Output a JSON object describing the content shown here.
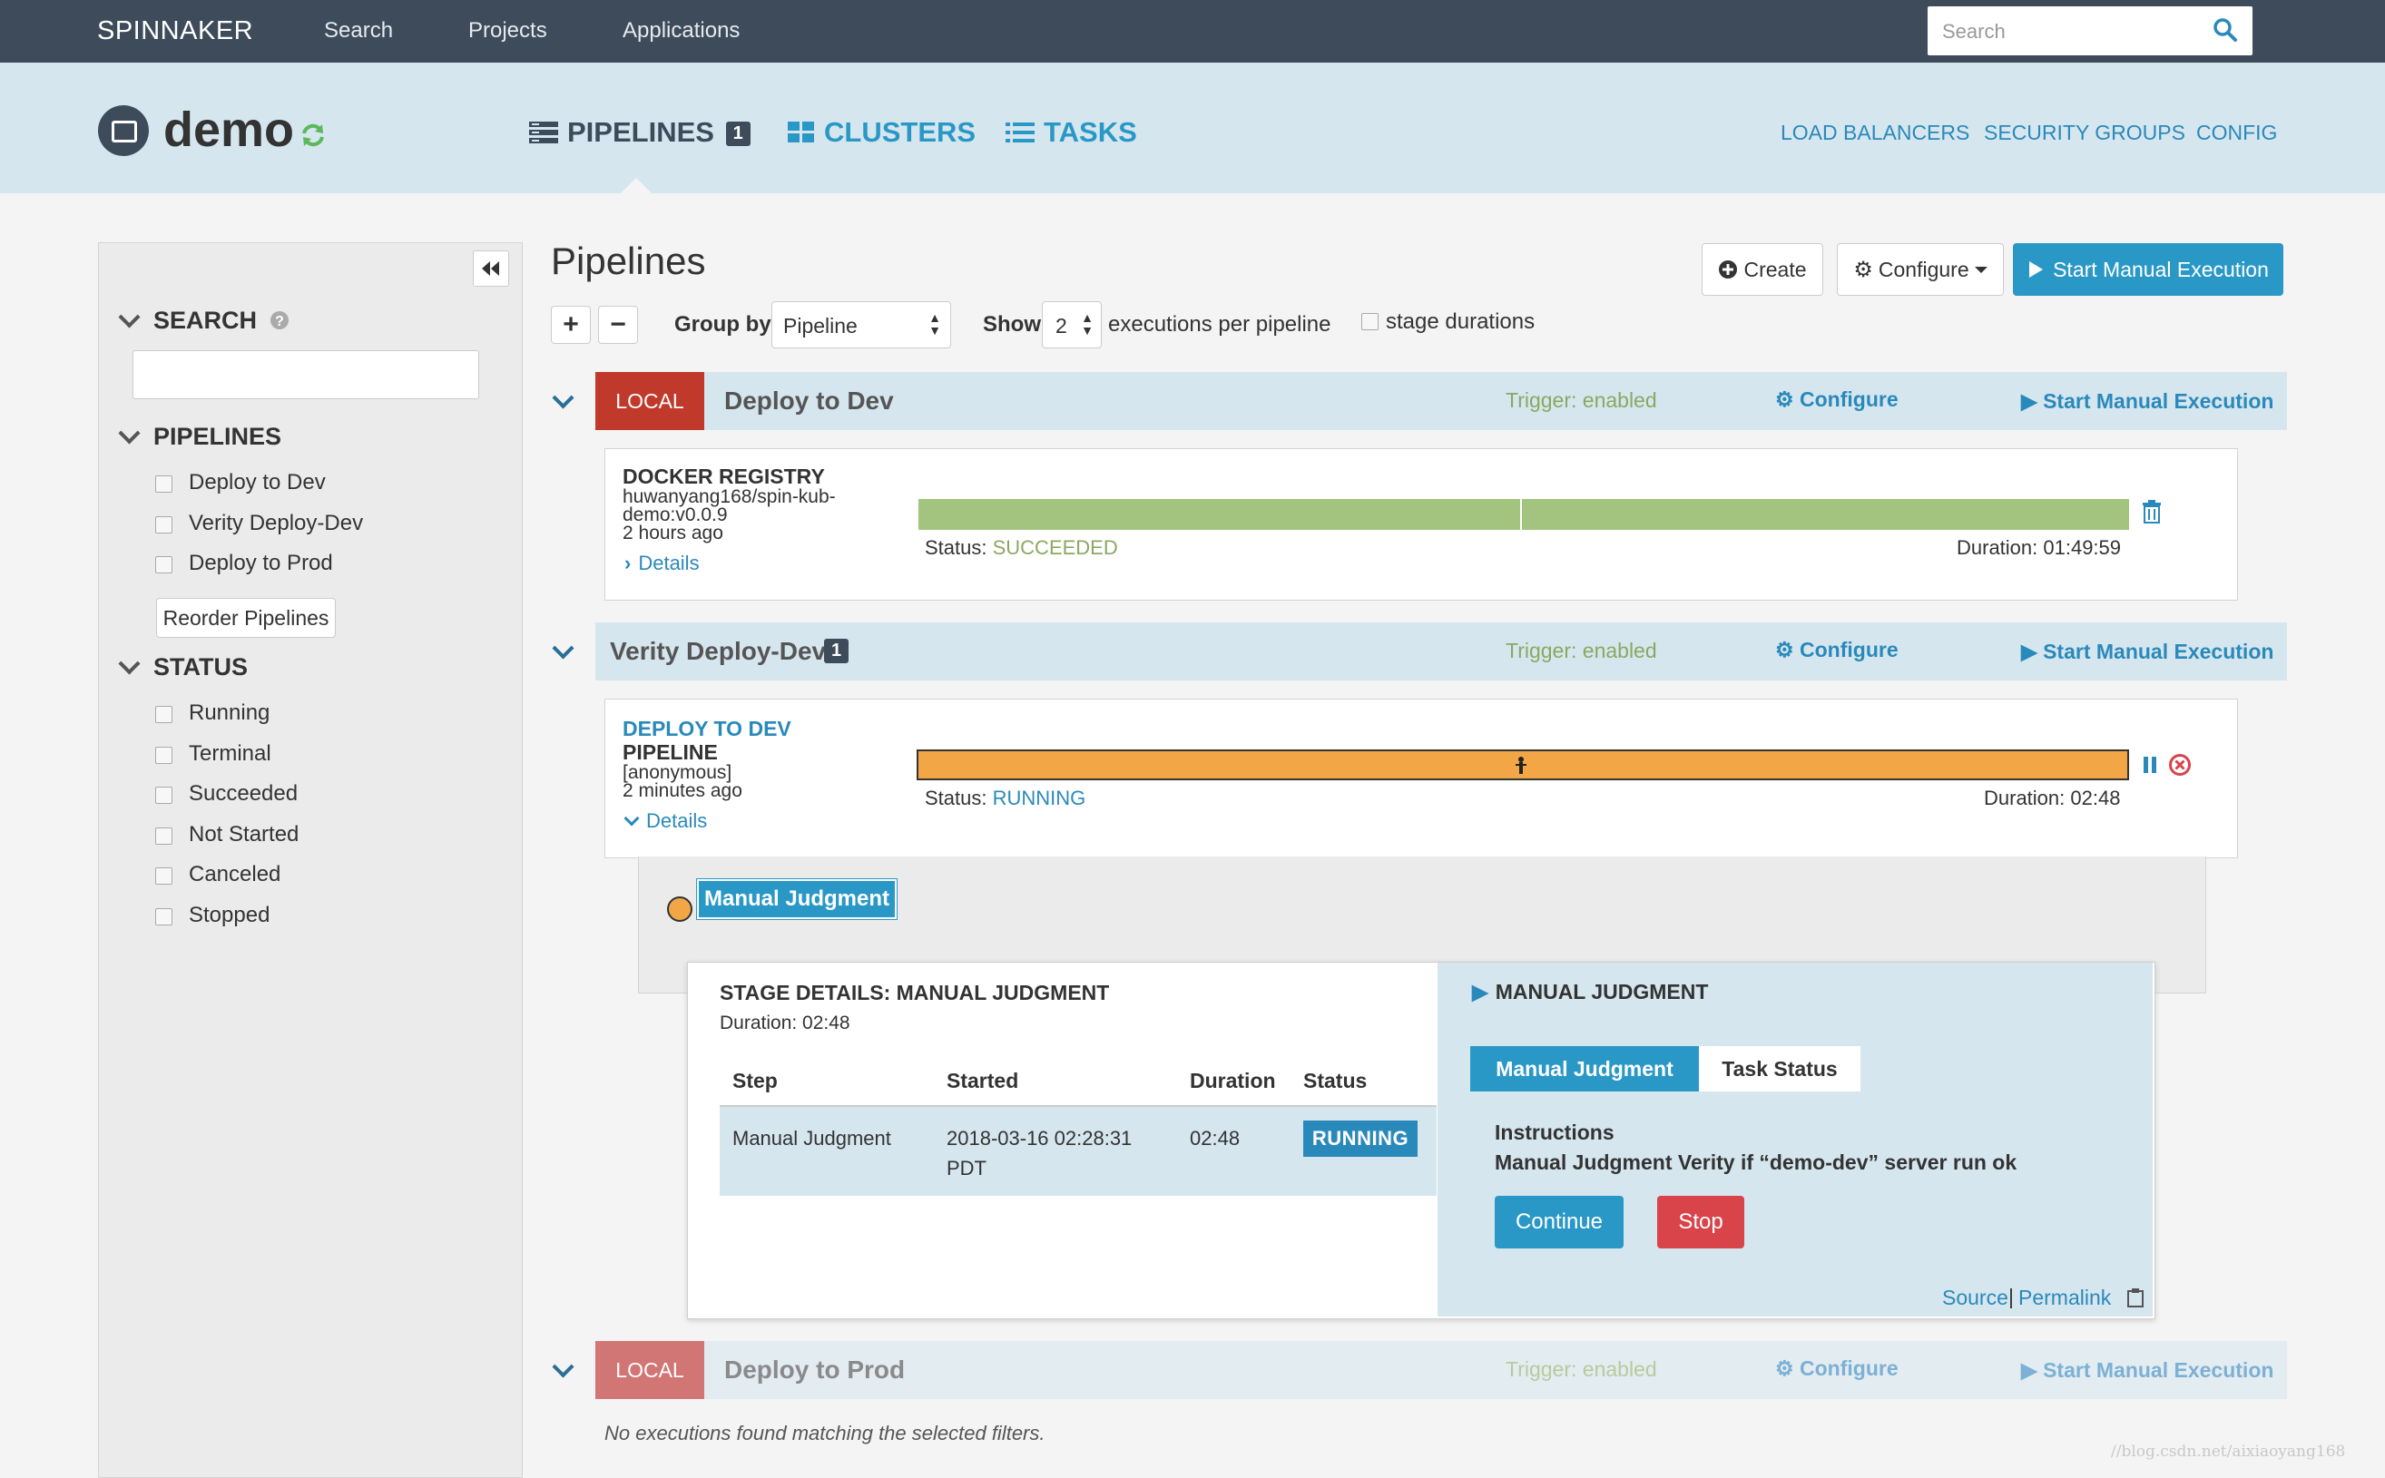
{
  "topnav": {
    "brand": "SPINNAKER",
    "links": [
      "Search",
      "Projects",
      "Applications"
    ],
    "search_placeholder": "Search"
  },
  "app": {
    "name": "demo",
    "tabs": [
      {
        "label": "PIPELINES",
        "badge": "1"
      },
      {
        "label": "CLUSTERS"
      },
      {
        "label": "TASKS"
      }
    ],
    "right_links": [
      "LOAD BALANCERS",
      "SECURITY GROUPS",
      "CONFIG"
    ]
  },
  "sidebar": {
    "search_heading": "SEARCH",
    "pipelines_heading": "PIPELINES",
    "pipelines": [
      "Deploy to Dev",
      "Verity Deploy-Dev",
      "Deploy to Prod"
    ],
    "reorder_label": "Reorder Pipelines",
    "status_heading": "STATUS",
    "statuses": [
      "Running",
      "Terminal",
      "Succeeded",
      "Not Started",
      "Canceled",
      "Stopped"
    ]
  },
  "main": {
    "title": "Pipelines",
    "create_label": "Create",
    "configure_label": "Configure",
    "start_manual_label": "Start Manual Execution",
    "group_by_label": "Group by",
    "group_by_value": "Pipeline",
    "show_label": "Show",
    "show_value": "2",
    "per_pipeline_label": "executions per pipeline",
    "stage_durations_label": "stage durations"
  },
  "groups": [
    {
      "badge": "LOCAL",
      "name": "Deploy to Dev",
      "trigger": "Trigger: enabled",
      "configure": "Configure",
      "start": "Start Manual Execution",
      "exec": {
        "trigger_type": "DOCKER REGISTRY",
        "line1": "huwanyang168/spin-kub-",
        "line2": "demo:v0.0.9",
        "age": "2 hours ago",
        "details": "Details",
        "status_label": "Status:",
        "status": "SUCCEEDED",
        "duration": "Duration: 01:49:59",
        "progress": 1.0
      }
    },
    {
      "name": "Verity Deploy-Dev",
      "badge_count": "1",
      "trigger": "Trigger: enabled",
      "configure": "Configure",
      "start": "Start Manual Execution",
      "exec": {
        "trigger_type": "DEPLOY TO DEV",
        "line1": "PIPELINE",
        "line2": "[anonymous]",
        "age": "2 minutes ago",
        "details": "Details",
        "status_label": "Status:",
        "status": "RUNNING",
        "duration": "Duration: 02:48",
        "progress": 1.0
      }
    },
    {
      "badge": "LOCAL",
      "name": "Deploy to Prod",
      "trigger": "Trigger: enabled",
      "configure": "Configure",
      "start": "Start Manual Execution",
      "empty": "No executions found matching the selected filters."
    }
  ],
  "stage": {
    "label": "Manual Judgment",
    "details_title": "STAGE DETAILS: MANUAL JUDGMENT",
    "duration": "Duration: 02:48",
    "columns": [
      "Step",
      "Started",
      "Duration",
      "Status"
    ],
    "row": {
      "step": "Manual Judgment",
      "started1": "2018-03-16 02:28:31",
      "started2": "PDT",
      "duration": "02:48",
      "status": "RUNNING"
    },
    "right_title": "MANUAL JUDGMENT",
    "tabs": [
      "Manual Judgment",
      "Task Status"
    ],
    "instructions_label": "Instructions",
    "instructions": "Manual Judgment Verity if “demo-dev” server run ok",
    "continue_label": "Continue",
    "stop_label": "Stop",
    "source_label": "Source",
    "permalink_label": "Permalink"
  },
  "watermark": "//blog.csdn.net/aixiaoyang168",
  "colors": {
    "nav": "#3d4b5b",
    "accent": "#2a98c7",
    "success_bar": "#a3c47f",
    "running_bar": "#f2a645",
    "danger": "#d9434a"
  }
}
